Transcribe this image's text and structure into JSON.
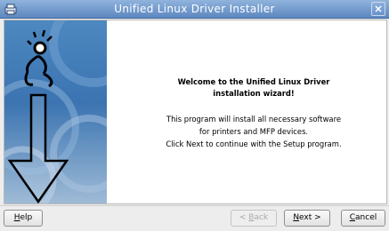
{
  "window": {
    "title": "Unified Linux Driver Installer",
    "icon": "app-icon",
    "close_icon": "close-icon"
  },
  "welcome": {
    "line1": "Welcome to the Unified Linux Driver",
    "line2": "installation wizard!"
  },
  "description": {
    "line1": "This program will install all necessary software",
    "line2": "for printers and MFP devices.",
    "line3": "Click Next to continue with the Setup program."
  },
  "buttons": {
    "help": {
      "key": "H",
      "rest": "elp"
    },
    "back": {
      "pre": "< ",
      "key": "B",
      "rest": "ack"
    },
    "next": {
      "key": "N",
      "rest": "ext >"
    },
    "cancel": {
      "key": "C",
      "rest": "ancel"
    }
  },
  "colors": {
    "titlebar": "#6b93c8",
    "sidebar": "#4580bd"
  }
}
